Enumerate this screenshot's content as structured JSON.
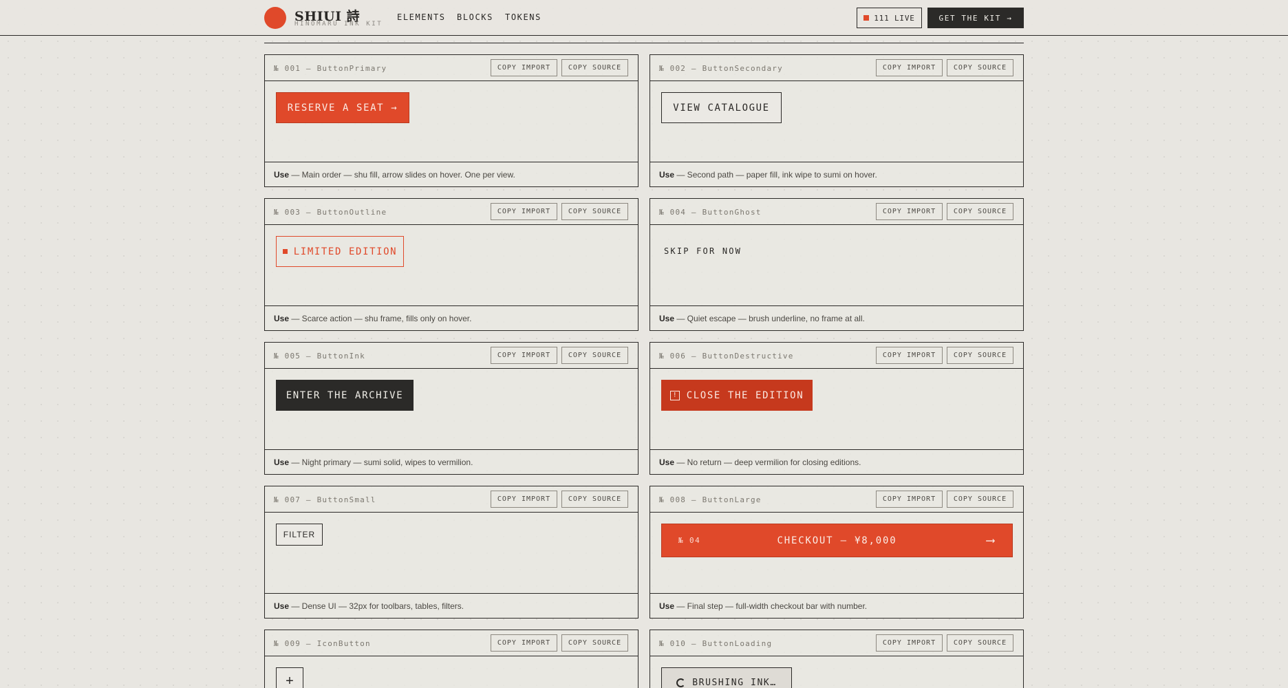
{
  "header": {
    "brand": "SHIUI 詩",
    "brand_sub": "HINOMARU INK KIT",
    "nav": [
      "ELEMENTS",
      "BLOCKS",
      "TOKENS"
    ],
    "live_label": "111 LIVE",
    "cta_label": "GET THE KIT →"
  },
  "copy_import_label": "COPY IMPORT",
  "copy_source_label": "COPY SOURCE",
  "use_label": "Use",
  "cards": [
    {
      "id": "№ 001 — ButtonPrimary",
      "button": "RESERVE A SEAT →",
      "desc": " — Main order — shu fill, arrow slides on hover. One per view."
    },
    {
      "id": "№ 002 — ButtonSecondary",
      "button": "VIEW CATALOGUE",
      "desc": " — Second path — paper fill, ink wipe to sumi on hover."
    },
    {
      "id": "№ 003 — ButtonOutline",
      "button": "LIMITED EDITION",
      "desc": " — Scarce action — shu frame, fills only on hover."
    },
    {
      "id": "№ 004 — ButtonGhost",
      "button": "SKIP FOR NOW",
      "desc": " — Quiet escape — brush underline, no frame at all."
    },
    {
      "id": "№ 005 — ButtonInk",
      "button": "ENTER THE ARCHIVE",
      "desc": " — Night primary — sumi solid, wipes to vermilion."
    },
    {
      "id": "№ 006 — ButtonDestructive",
      "button": "CLOSE THE EDITION",
      "icon_glyph": "!",
      "desc": " — No return — deep vermilion for closing editions."
    },
    {
      "id": "№ 007 — ButtonSmall",
      "button": "FILTER",
      "desc": " — Dense UI — 32px for toolbars, tables, filters."
    },
    {
      "id": "№ 008 — ButtonLarge",
      "number": "№ 04",
      "button": "CHECKOUT — ¥8,000",
      "arrow": "⟶",
      "desc": " — Final step — full-width checkout bar with number."
    },
    {
      "id": "№ 009 — IconButton",
      "button": "+"
    },
    {
      "id": "№ 010 — ButtonLoading",
      "button": "BRUSHING INK…"
    }
  ],
  "colors": {
    "shu": "#e0492a",
    "sumi": "#2b2a28",
    "paper": "#e8e6e1",
    "deep_vermilion": "#c6391d"
  }
}
